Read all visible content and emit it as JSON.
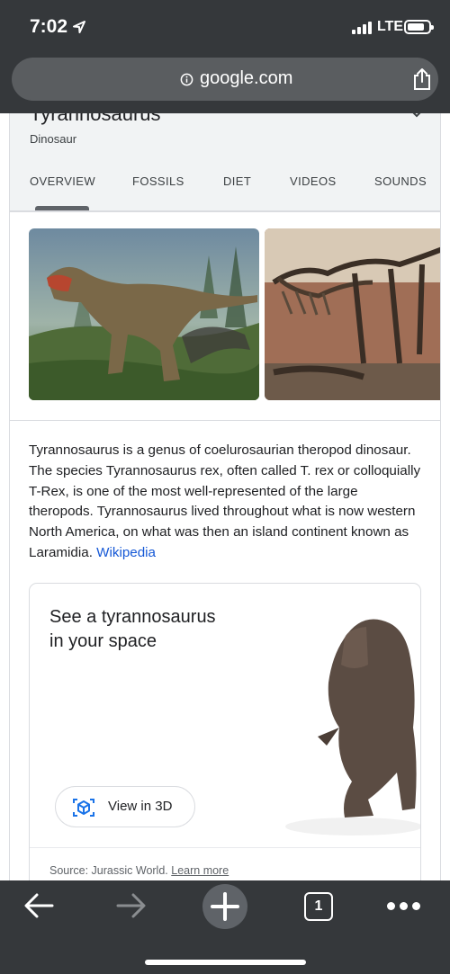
{
  "status_bar": {
    "time": "7:02",
    "network": "LTE"
  },
  "url_bar": {
    "url": "google.com"
  },
  "knowledge_panel": {
    "title": "Tyrannosaurus",
    "subtitle": "Dinosaur",
    "tabs": [
      {
        "label": "OVERVIEW",
        "selected": true
      },
      {
        "label": "FOSSILS"
      },
      {
        "label": "DIET"
      },
      {
        "label": "VIDEOS"
      },
      {
        "label": "SOUNDS"
      }
    ],
    "images": [
      {
        "name": "t-rex-illustration"
      },
      {
        "name": "t-rex-skeleton"
      }
    ],
    "description": "Tyrannosaurus is a genus of coelurosaurian theropod dinosaur. The species Tyrannosaurus rex, often called T. rex or colloquially T-Rex, is one of the most well-represented of the large theropods. Tyrannosaurus lived throughout what is now western North America, on what was then an island continent known as Laramidia.",
    "description_link": "Wikipedia"
  },
  "ar_card": {
    "title": "See a tyrannosaurus in your space",
    "button_label": "View in 3D",
    "source_text": "Source: Jurassic World.",
    "learn_more": "Learn more"
  },
  "bottom_bar": {
    "tab_count": "1",
    "icons": [
      "back-arrow-icon",
      "forward-arrow-icon",
      "plus-icon",
      "tabs-icon",
      "more-icon"
    ]
  },
  "colors": {
    "chrome": "#35383b",
    "link": "#1558d6",
    "panel_bg": "#f1f3f4"
  }
}
